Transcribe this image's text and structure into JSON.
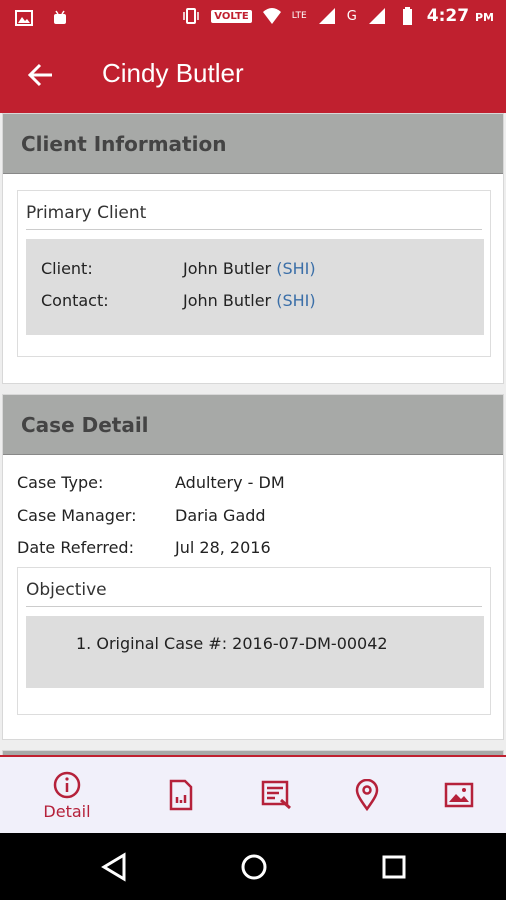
{
  "status_bar": {
    "volte": "VOLTE",
    "lte": "LTE",
    "g": "G",
    "time": "4:27",
    "ampm": "PM"
  },
  "app_bar": {
    "title": "Cindy Butler"
  },
  "client_info": {
    "header": "Client Information",
    "primary_title": "Primary Client",
    "rows": [
      {
        "label": "Client:",
        "value": "John Butler",
        "tag": "(SHI)"
      },
      {
        "label": "Contact:",
        "value": "John Butler",
        "tag": "(SHI)"
      }
    ]
  },
  "case_detail": {
    "header": "Case Detail",
    "rows": [
      {
        "label": "Case Type:",
        "value": "Adultery - DM"
      },
      {
        "label": "Case Manager:",
        "value": "Daria Gadd"
      },
      {
        "label": "Date Referred:",
        "value": "Jul 28, 2016"
      }
    ],
    "objective_title": "Objective",
    "objective_item": "1. Original Case #: 2016-07-DM-00042"
  },
  "bottom_nav": {
    "detail_label": "Detail",
    "icons": [
      "info-icon",
      "report-icon",
      "notes-icon",
      "location-icon",
      "image-icon"
    ]
  },
  "colors": {
    "primary": "#c0202f",
    "link": "#3b6fa8",
    "header_gray": "#a7a9a7"
  }
}
